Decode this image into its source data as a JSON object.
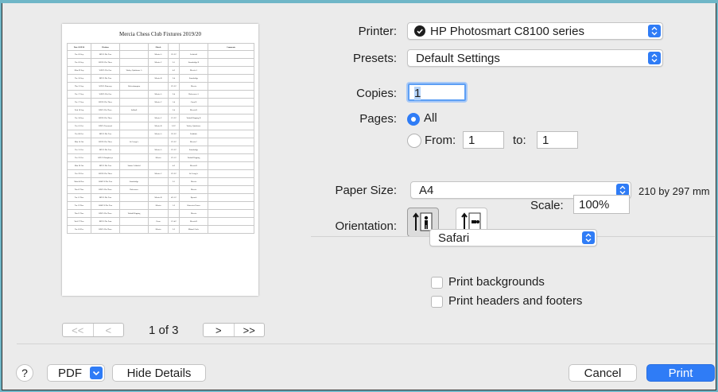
{
  "preview": {
    "doc_title": "Mercia Chess Club Fixtures 2019/20",
    "table_headers": [
      "Date 2019/20",
      "Division",
      "",
      "Match",
      "",
      "",
      "Comments"
    ],
    "rows": [
      [
        "Tue 03 Sep",
        "BDCL Div Two",
        "",
        "Mercia A",
        "3½-2½",
        "Lichfield",
        ""
      ],
      [
        "Tue 03 Sep",
        "WDCL Div Three",
        "",
        "Mercia C",
        "3-1",
        "Stourbridge B",
        ""
      ],
      [
        "Mon 09 Sep",
        "WDCL Div One",
        "Warley Quinborne A",
        "",
        "4-2",
        "Mercia A",
        ""
      ],
      [
        "Tue 10 Sep",
        "BDCL Div Two",
        "",
        "Mercia B",
        "2-4",
        "Stourbridge",
        ""
      ],
      [
        "Thu 12 Sep",
        "WDCL Plateway",
        "Wolverhampton",
        "",
        "2½-3½",
        "Mercia",
        ""
      ],
      [
        "Tue 17 Sep",
        "WDCL Div One",
        "",
        "Mercia A",
        "2-4",
        "Halesowen A",
        ""
      ],
      [
        "Tue 17 Sep",
        "WDCL Div Three",
        "",
        "Mercia C",
        "1-4",
        "Oxon B",
        ""
      ],
      [
        "Wed 18 Sep",
        "BDCL Div Three",
        "Solihull",
        "",
        "2-4",
        "Mercia B",
        ""
      ],
      [
        "Tue 24 Sep",
        "WDCL Div Three",
        "",
        "Mercia C",
        "1½-2½",
        "Walsall Kipping B",
        ""
      ],
      [
        "Tue 01 Oct",
        "BDCL Townsend",
        "",
        "Mercia B",
        "3-3½",
        "Warley Quinborne",
        ""
      ],
      [
        "Tue 08 Oct",
        "BDCL Div Two",
        "",
        "Mercia A",
        "3½-2½",
        "Redditch",
        ""
      ],
      [
        "Mon 14 Oct",
        "WDCL Div Three",
        "St George's",
        "",
        "2½-3½",
        "Mercia C",
        ""
      ],
      [
        "Tue 15 Oct",
        "BDCL Div Two",
        "",
        "Mercia A",
        "2½-3½",
        "Stourbridge",
        ""
      ],
      [
        "Tue 22 Oct",
        "WDCL Humphreys",
        "",
        "Mercia",
        "2½-1½",
        "Walsall Kipping",
        ""
      ],
      [
        "Mon 28 Oct",
        "BDCL Div Two",
        "Sutton Coldfield",
        "",
        "4-2",
        "Mercia B",
        ""
      ],
      [
        "Tue 29 Oct",
        "WDCL Div Three",
        "",
        "Mercia C",
        "2½-2½",
        "St George's",
        ""
      ],
      [
        "Mon 04 Nov",
        "WkDCL Div Two",
        "Stourbridge",
        "",
        "3-1",
        "Mercia",
        ""
      ],
      [
        "Thu 07 Nov",
        "BDCL Div Three",
        "Halesowen",
        "",
        "",
        "Mercia",
        ""
      ],
      [
        "Tue 12 Nov",
        "BDCL Div Two",
        "",
        "Mercia B",
        "4½-1½",
        "Kynoch",
        ""
      ],
      [
        "Tue 19 Nov",
        "WkDCL Div Two",
        "",
        "Mercia",
        "1-3",
        "Worcester Passes",
        ""
      ],
      [
        "Thu 21 Nov",
        "BDCL Div Three",
        "Walsall Kipping",
        "",
        "",
        "Mercia",
        ""
      ],
      [
        "Wed 27 Nov",
        "BDCL Div Four",
        "",
        "Oxon",
        "1½-4½",
        "Mercia B",
        ""
      ],
      [
        "Tue 03 Dec",
        "BDCL Div Three",
        "",
        "Mercia",
        "2-2",
        "Mistral Circle",
        ""
      ]
    ]
  },
  "pager": {
    "first": "<<",
    "prev": "<",
    "page_label": "1 of 3",
    "next": ">",
    "last": ">>"
  },
  "form": {
    "printer_label": "Printer:",
    "printer_value": "HP Photosmart C8100 series",
    "presets_label": "Presets:",
    "presets_value": "Default Settings",
    "copies_label": "Copies:",
    "copies_value": "1",
    "pages_label": "Pages:",
    "pages_all": "All",
    "pages_from_label": "From:",
    "pages_from_value": "1",
    "pages_to_label": "to:",
    "pages_to_value": "1",
    "paper_size_label": "Paper Size:",
    "paper_size_value": "A4",
    "paper_size_dims": "210 by 297 mm",
    "orientation_label": "Orientation:",
    "scale_label": "Scale:",
    "scale_value": "100%",
    "app_popup_value": "Safari",
    "print_backgrounds": "Print backgrounds",
    "print_headers_footers": "Print headers and footers"
  },
  "footer": {
    "help": "?",
    "pdf": "PDF",
    "hide_details": "Hide Details",
    "cancel": "Cancel",
    "print": "Print"
  },
  "colors": {
    "accent": "#2f7cf6",
    "desktop": "#6fb6c7",
    "sheet": "#ebebeb"
  },
  "icons": {
    "printer_status": "printer-status-icon",
    "portrait": "portrait-orientation-icon",
    "landscape": "landscape-orientation-icon",
    "popup_arrows": "updown-chevron-icon"
  }
}
